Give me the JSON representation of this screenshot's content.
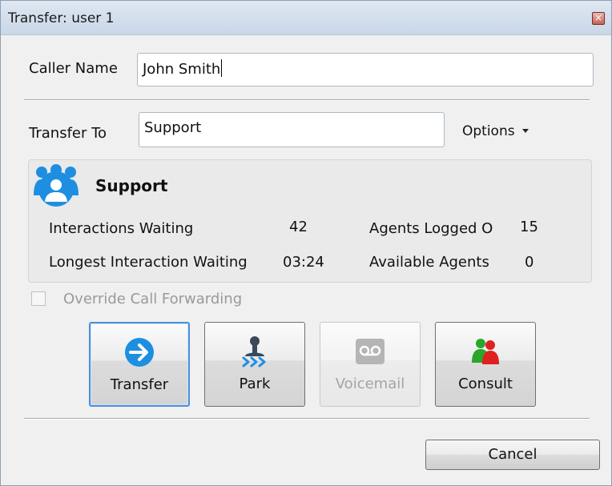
{
  "window": {
    "title": "Transfer: user 1",
    "close_glyph": "×"
  },
  "caller": {
    "label": "Caller Name",
    "value": "John Smith"
  },
  "transfer": {
    "label": "Transfer To",
    "value": "Support",
    "options_label": "Options"
  },
  "group": {
    "name": "Support",
    "icon": "group-people-icon",
    "stats": {
      "interactions_waiting_label": "Interactions Waiting",
      "interactions_waiting_value": "42",
      "longest_label": "Longest Interaction Waiting",
      "longest_value": "03:24",
      "agents_logged_label": "Agents Logged O",
      "agents_logged_value": "15",
      "available_label": "Available Agents",
      "available_value": "0"
    }
  },
  "override": {
    "label": "Override Call Forwarding",
    "checked": false,
    "enabled": false
  },
  "actions": [
    {
      "label": "Transfer",
      "icon": "arrow-right-circle-icon",
      "state": "selected"
    },
    {
      "label": "Park",
      "icon": "park-person-arrows-icon",
      "state": "normal"
    },
    {
      "label": "Voicemail",
      "icon": "voicemail-icon",
      "state": "disabled"
    },
    {
      "label": "Consult",
      "icon": "consult-people-icon",
      "state": "normal"
    }
  ],
  "footer": {
    "cancel_label": "Cancel"
  },
  "colors": {
    "accent_blue": "#1e8fe0",
    "selected_border": "#4a90d9",
    "consult_red": "#e02020",
    "consult_green": "#2aa62a",
    "park_dark": "#3a4a5a"
  }
}
